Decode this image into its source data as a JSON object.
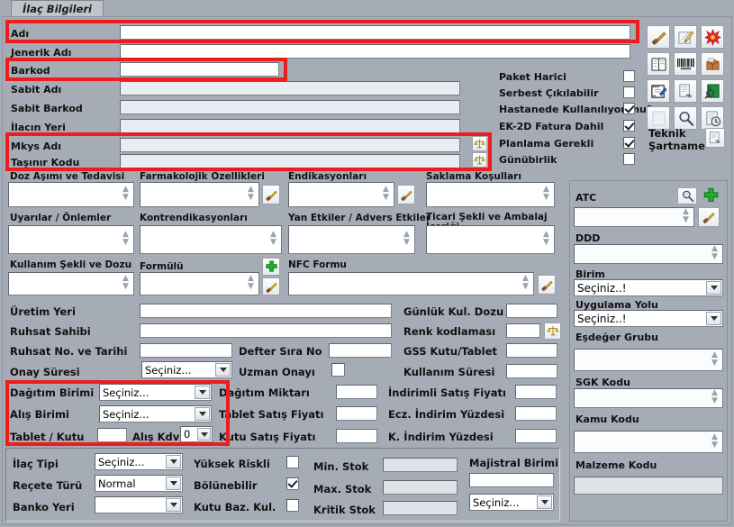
{
  "window": {
    "tab_label": "İlaç Bilgileri",
    "accent_highlight_color": "#ee1c1c",
    "background_color": "#a6acb5"
  },
  "identity_section": {
    "fields": [
      {
        "label": "Adı",
        "value": "",
        "readonly": false,
        "highlighted": true
      },
      {
        "label": "Jenerik Adı",
        "value": "",
        "readonly": false,
        "highlighted": false
      },
      {
        "label": "Barkod",
        "value": "",
        "readonly": false,
        "highlighted": true
      },
      {
        "label": "Sabit Adı",
        "value": "",
        "readonly": true,
        "highlighted": false
      },
      {
        "label": "Sabit Barkod",
        "value": "",
        "readonly": true,
        "highlighted": false
      },
      {
        "label": "İlacın Yeri",
        "value": "",
        "readonly": true,
        "highlighted": false
      },
      {
        "label": "Mkys Adı",
        "value": "",
        "readonly": true,
        "highlighted": true
      },
      {
        "label": "Taşınır Kodu",
        "value": "",
        "readonly": true,
        "highlighted": true
      }
    ],
    "lookup_icon_name": "scales-lookup-icon"
  },
  "checkboxes": [
    {
      "label": "Paket Harici",
      "checked": false
    },
    {
      "label": "Serbest Çıkılabilir",
      "checked": false
    },
    {
      "label": "Hastanede Kullanılıyor mu?",
      "checked": true
    },
    {
      "label": "EK-2D Fatura Dahil",
      "checked": true
    },
    {
      "label": "Planlama Gerekli",
      "checked": true
    },
    {
      "label": "Günübirlik",
      "checked": false
    }
  ],
  "toolbar": {
    "icons": [
      {
        "name": "pen-write-icon"
      },
      {
        "name": "pencil-note-icon"
      },
      {
        "name": "red-starburst-icon"
      },
      {
        "name": "open-book-icon"
      },
      {
        "name": "barcode-icon"
      },
      {
        "name": "package-box-icon"
      },
      {
        "name": "form-edit-icon"
      },
      {
        "name": "document-copy-icon"
      },
      {
        "name": "green-book-search-icon"
      },
      {
        "name": "blank-page-icon"
      },
      {
        "name": "magnifier-icon"
      },
      {
        "name": "document-clock-icon"
      }
    ],
    "technical_spec_label": "Teknik\nŞartname",
    "technical_spec_label_line1": "Teknik",
    "technical_spec_label_line2": "Şartname",
    "technical_spec_icon": "document-arrow-icon"
  },
  "text_sections": {
    "row1": [
      {
        "label": "Doz Aşımı ve Tedavisi",
        "value": "",
        "has_edit_icon": false
      },
      {
        "label": "Farmakolojik Özellikleri",
        "value": "",
        "has_edit_icon": true
      },
      {
        "label": "Endikasyonları",
        "value": "",
        "has_edit_icon": true
      },
      {
        "label": "Saklama Koşulları",
        "value": "",
        "has_edit_icon": false
      }
    ],
    "row2": [
      {
        "label": "Uyarılar / Önlemler",
        "value": "",
        "has_edit_icon": false
      },
      {
        "label": "Kontrendikasyonları",
        "value": "",
        "has_edit_icon": false
      },
      {
        "label": "Yan Etkiler / Advers Etkiler",
        "value": "",
        "has_edit_icon": false
      },
      {
        "label": "Ticari Şekli ve Ambalaj İçeriği",
        "value": "",
        "has_edit_icon": false
      }
    ],
    "row3": [
      {
        "label": "Kullanım Şekli ve Dozu",
        "value": "",
        "has_edit_icon": false,
        "has_add_icon": false
      },
      {
        "label": "Formülü",
        "value": "",
        "has_edit_icon": true,
        "has_add_icon": true
      },
      {
        "label": "NFC Formu",
        "value": "",
        "has_edit_icon": true,
        "has_add_icon": false
      }
    ],
    "edit_icon_name": "pen-write-icon",
    "add_icon_name": "green-plus-icon"
  },
  "registration_section": {
    "left_fields": [
      {
        "label": "Üretim Yeri",
        "value": ""
      },
      {
        "label": "Ruhsat Sahibi",
        "value": ""
      },
      {
        "label": "Ruhsat No. ve Tarihi",
        "value": ""
      }
    ],
    "onay_suresi_label": "Onay Süresi",
    "onay_suresi_value": "Seçiniz...",
    "defter_sira_no_label": "Defter Sıra No",
    "defter_sira_no_value": "",
    "uzman_onayi_label": "Uzman Onayı",
    "uzman_onayi_checked": false,
    "right_fields": [
      {
        "label": "Günlük Kul. Dozu",
        "value": "",
        "has_icon": false
      },
      {
        "label": "Renk kodlaması",
        "value": "",
        "has_icon": true,
        "icon_name": "color-palette-icon"
      },
      {
        "label": "GSS Kutu/Tablet",
        "value": "",
        "has_icon": false
      },
      {
        "label": "Kullanım Süresi",
        "value": "",
        "has_icon": false
      }
    ]
  },
  "pricing_section": {
    "highlighted": true,
    "dagitim_birimi_label": "Dağıtım Birimi",
    "dagitim_birimi_value": "Seçiniz...",
    "alis_birimi_label": "Alış Birimi",
    "alis_birimi_value": "Seçiniz...",
    "tablet_kutu_label": "Tablet / Kutu",
    "tablet_kutu_value": "",
    "alis_kdv_label": "Alış Kdv",
    "alis_kdv_value": "0",
    "mid_fields": [
      {
        "label": "Dağıtım Miktarı",
        "value": ""
      },
      {
        "label": "Tablet Satış Fiyatı",
        "value": ""
      },
      {
        "label": "Kutu Satış Fiyatı",
        "value": ""
      }
    ],
    "right_fields": [
      {
        "label": "İndirimli Satış Fiyatı",
        "value": ""
      },
      {
        "label": "Ecz. İndirim Yüzdesi",
        "value": ""
      },
      {
        "label": "K. İndirim Yüzdesi",
        "value": ""
      }
    ]
  },
  "bottom_section": {
    "left_fields": [
      {
        "label": "İlaç Tipi",
        "value": "Seçiniz..."
      },
      {
        "label": "Reçete Türü",
        "value": "Normal"
      },
      {
        "label": "Banko Yeri",
        "value": ""
      }
    ],
    "checkboxes": [
      {
        "label": "Yüksek Riskli",
        "checked": false
      },
      {
        "label": "Bölünebilir",
        "checked": true
      },
      {
        "label": "Kutu Baz. Kul.",
        "checked": false
      }
    ],
    "stock_fields": [
      {
        "label": "Min. Stok",
        "value": ""
      },
      {
        "label": "Max. Stok",
        "value": ""
      },
      {
        "label": "Kritik Stok",
        "value": ""
      }
    ],
    "majistral_label": "Majistral Birimi",
    "majistral_value": "",
    "majistral_select_value": "Seçiniz..."
  },
  "side_panel": {
    "atc_label": "ATC",
    "atc_value": "",
    "atc_search_icon": "magnifier-icon",
    "atc_add_icon": "green-plus-icon",
    "atc_edit_icon": "pen-write-icon",
    "ddd_label": "DDD",
    "ddd_value": "",
    "birim_label": "Birim",
    "birim_value": "Seçiniz..!",
    "uygulama_yolu_label": "Uygulama Yolu",
    "uygulama_yolu_value": "Seçiniz..!",
    "esdeger_grubu_label": "Eşdeğer Grubu",
    "esdeger_grubu_value": "",
    "sgk_kodu_label": "SGK Kodu",
    "sgk_kodu_value": "",
    "kamu_kodu_label": "Kamu Kodu",
    "kamu_kodu_value": "",
    "malzeme_kodu_label": "Malzeme Kodu",
    "malzeme_kodu_value": ""
  }
}
